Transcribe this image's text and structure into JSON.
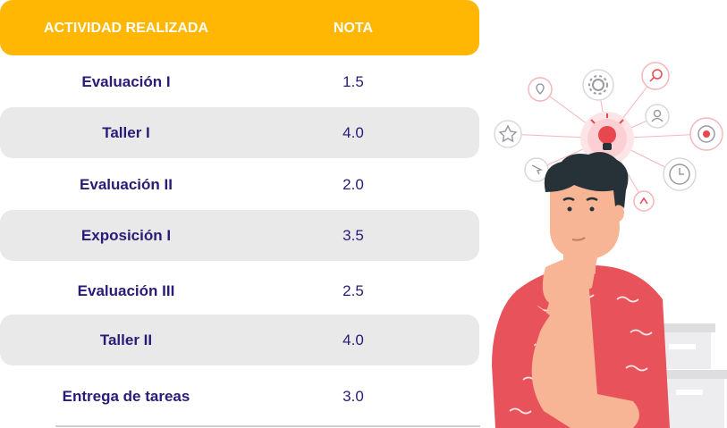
{
  "table": {
    "headers": {
      "activity": "ACTIVIDAD REALIZADA",
      "grade": "NOTA"
    },
    "rows": [
      {
        "activity": "Evaluación I",
        "grade": "1.5"
      },
      {
        "activity": "Taller I",
        "grade": "4.0"
      },
      {
        "activity": "Evaluación II",
        "grade": "2.0"
      },
      {
        "activity": "Exposición I",
        "grade": "3.5"
      },
      {
        "activity": "Evaluación III",
        "grade": "2.5"
      },
      {
        "activity": "Taller II",
        "grade": "4.0"
      },
      {
        "activity": "Entrega de tareas",
        "grade": "3.0"
      }
    ]
  },
  "colors": {
    "header_bg": "#FFB703",
    "row_shade": "#E9E9EA",
    "text": "#2B1A78",
    "bulb": "#E8474F",
    "shirt": "#E8525A",
    "hair": "#263238",
    "skin": "#F7B596"
  },
  "illustration": {
    "icons": [
      "lightbulb-icon",
      "gear-icon",
      "search-icon",
      "user-icon",
      "star-icon",
      "location-icon",
      "target-icon",
      "cursor-icon",
      "share-icon",
      "clock-icon"
    ]
  }
}
